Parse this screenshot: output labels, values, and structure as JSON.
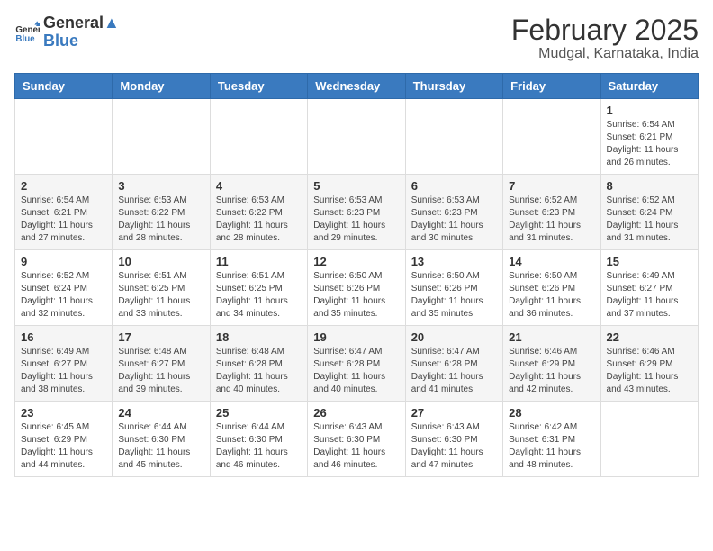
{
  "header": {
    "logo_general": "General",
    "logo_blue": "Blue",
    "month": "February 2025",
    "location": "Mudgal, Karnataka, India"
  },
  "weekdays": [
    "Sunday",
    "Monday",
    "Tuesday",
    "Wednesday",
    "Thursday",
    "Friday",
    "Saturday"
  ],
  "weeks": [
    [
      {
        "day": "",
        "info": ""
      },
      {
        "day": "",
        "info": ""
      },
      {
        "day": "",
        "info": ""
      },
      {
        "day": "",
        "info": ""
      },
      {
        "day": "",
        "info": ""
      },
      {
        "day": "",
        "info": ""
      },
      {
        "day": "1",
        "info": "Sunrise: 6:54 AM\nSunset: 6:21 PM\nDaylight: 11 hours and 26 minutes."
      }
    ],
    [
      {
        "day": "2",
        "info": "Sunrise: 6:54 AM\nSunset: 6:21 PM\nDaylight: 11 hours and 27 minutes."
      },
      {
        "day": "3",
        "info": "Sunrise: 6:53 AM\nSunset: 6:22 PM\nDaylight: 11 hours and 28 minutes."
      },
      {
        "day": "4",
        "info": "Sunrise: 6:53 AM\nSunset: 6:22 PM\nDaylight: 11 hours and 28 minutes."
      },
      {
        "day": "5",
        "info": "Sunrise: 6:53 AM\nSunset: 6:23 PM\nDaylight: 11 hours and 29 minutes."
      },
      {
        "day": "6",
        "info": "Sunrise: 6:53 AM\nSunset: 6:23 PM\nDaylight: 11 hours and 30 minutes."
      },
      {
        "day": "7",
        "info": "Sunrise: 6:52 AM\nSunset: 6:23 PM\nDaylight: 11 hours and 31 minutes."
      },
      {
        "day": "8",
        "info": "Sunrise: 6:52 AM\nSunset: 6:24 PM\nDaylight: 11 hours and 31 minutes."
      }
    ],
    [
      {
        "day": "9",
        "info": "Sunrise: 6:52 AM\nSunset: 6:24 PM\nDaylight: 11 hours and 32 minutes."
      },
      {
        "day": "10",
        "info": "Sunrise: 6:51 AM\nSunset: 6:25 PM\nDaylight: 11 hours and 33 minutes."
      },
      {
        "day": "11",
        "info": "Sunrise: 6:51 AM\nSunset: 6:25 PM\nDaylight: 11 hours and 34 minutes."
      },
      {
        "day": "12",
        "info": "Sunrise: 6:50 AM\nSunset: 6:26 PM\nDaylight: 11 hours and 35 minutes."
      },
      {
        "day": "13",
        "info": "Sunrise: 6:50 AM\nSunset: 6:26 PM\nDaylight: 11 hours and 35 minutes."
      },
      {
        "day": "14",
        "info": "Sunrise: 6:50 AM\nSunset: 6:26 PM\nDaylight: 11 hours and 36 minutes."
      },
      {
        "day": "15",
        "info": "Sunrise: 6:49 AM\nSunset: 6:27 PM\nDaylight: 11 hours and 37 minutes."
      }
    ],
    [
      {
        "day": "16",
        "info": "Sunrise: 6:49 AM\nSunset: 6:27 PM\nDaylight: 11 hours and 38 minutes."
      },
      {
        "day": "17",
        "info": "Sunrise: 6:48 AM\nSunset: 6:27 PM\nDaylight: 11 hours and 39 minutes."
      },
      {
        "day": "18",
        "info": "Sunrise: 6:48 AM\nSunset: 6:28 PM\nDaylight: 11 hours and 40 minutes."
      },
      {
        "day": "19",
        "info": "Sunrise: 6:47 AM\nSunset: 6:28 PM\nDaylight: 11 hours and 40 minutes."
      },
      {
        "day": "20",
        "info": "Sunrise: 6:47 AM\nSunset: 6:28 PM\nDaylight: 11 hours and 41 minutes."
      },
      {
        "day": "21",
        "info": "Sunrise: 6:46 AM\nSunset: 6:29 PM\nDaylight: 11 hours and 42 minutes."
      },
      {
        "day": "22",
        "info": "Sunrise: 6:46 AM\nSunset: 6:29 PM\nDaylight: 11 hours and 43 minutes."
      }
    ],
    [
      {
        "day": "23",
        "info": "Sunrise: 6:45 AM\nSunset: 6:29 PM\nDaylight: 11 hours and 44 minutes."
      },
      {
        "day": "24",
        "info": "Sunrise: 6:44 AM\nSunset: 6:30 PM\nDaylight: 11 hours and 45 minutes."
      },
      {
        "day": "25",
        "info": "Sunrise: 6:44 AM\nSunset: 6:30 PM\nDaylight: 11 hours and 46 minutes."
      },
      {
        "day": "26",
        "info": "Sunrise: 6:43 AM\nSunset: 6:30 PM\nDaylight: 11 hours and 46 minutes."
      },
      {
        "day": "27",
        "info": "Sunrise: 6:43 AM\nSunset: 6:30 PM\nDaylight: 11 hours and 47 minutes."
      },
      {
        "day": "28",
        "info": "Sunrise: 6:42 AM\nSunset: 6:31 PM\nDaylight: 11 hours and 48 minutes."
      },
      {
        "day": "",
        "info": ""
      }
    ]
  ]
}
